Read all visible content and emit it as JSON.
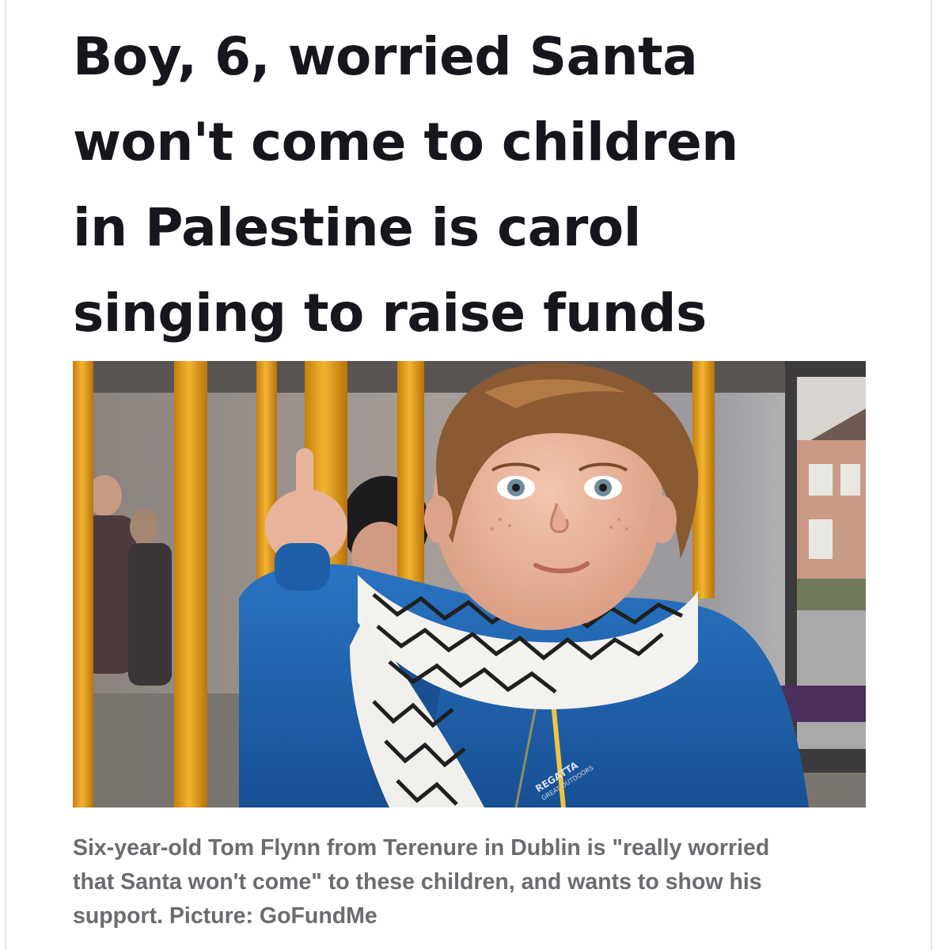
{
  "article": {
    "headline_lines": [
      "Boy, 6, worried Santa",
      "won't come to children",
      "in Palestine is carol",
      "singing to raise funds"
    ],
    "caption_lines": [
      "Six-year-old Tom Flynn from Terenure in Dublin is \"really worried",
      "that Santa won't come\" to these children, and wants to show his",
      "support. Picture: GoFundMe"
    ]
  },
  "photo": {
    "jacket_brand": "REGATTA",
    "jacket_brand_sub": "GREAT OUTDOORS",
    "colors": {
      "pole_yellow": "#e9a21c",
      "jacket_blue": "#1d62ad",
      "hair_brown": "#8a5a33",
      "skin": "#e8b59c"
    }
  }
}
